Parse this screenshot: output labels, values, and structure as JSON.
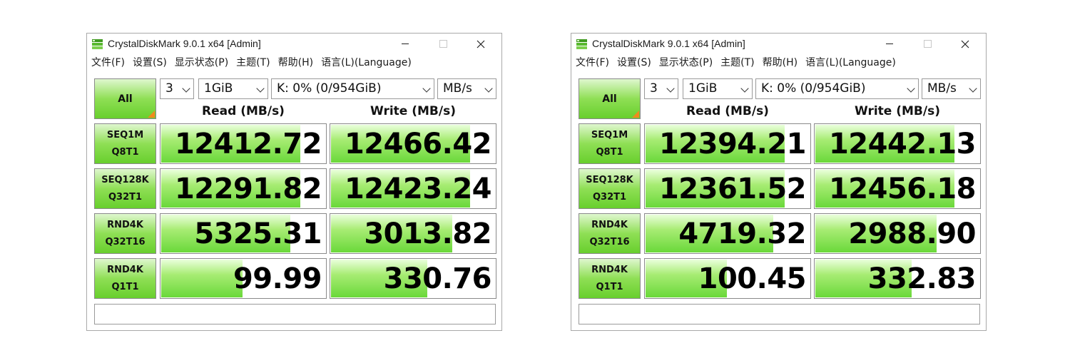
{
  "windows": [
    {
      "title": "CrystalDiskMark 9.0.1 x64 [Admin]",
      "menu": [
        "文件(F)",
        "设置(S)",
        "显示状态(P)",
        "主题(T)",
        "帮助(H)",
        "语言(L)(Language)"
      ],
      "all_label": "All",
      "count": "3",
      "size": "1GiB",
      "drive": "K: 0% (0/954GiB)",
      "unit": "MB/s",
      "read_header": "Read (MB/s)",
      "write_header": "Write (MB/s)",
      "tests": [
        {
          "line1": "SEQ1M",
          "line2": "Q8T1",
          "read": "12412.72",
          "write": "12466.42",
          "read_level": 0.85,
          "write_level": 0.85
        },
        {
          "line1": "SEQ128K",
          "line2": "Q32T1",
          "read": "12291.82",
          "write": "12423.24",
          "read_level": 0.85,
          "write_level": 0.85
        },
        {
          "line1": "RND4K",
          "line2": "Q32T16",
          "read": "5325.31",
          "write": "3013.82",
          "read_level": 0.79,
          "write_level": 0.74
        },
        {
          "line1": "RND4K",
          "line2": "Q1T1",
          "read": "99.99",
          "write": "330.76",
          "read_level": 0.5,
          "write_level": 0.59
        }
      ]
    },
    {
      "title": "CrystalDiskMark 9.0.1 x64 [Admin]",
      "menu": [
        "文件(F)",
        "设置(S)",
        "显示状态(P)",
        "主题(T)",
        "帮助(H)",
        "语言(L)(Language)"
      ],
      "all_label": "All",
      "count": "3",
      "size": "1GiB",
      "drive": "K: 0% (0/954GiB)",
      "unit": "MB/s",
      "read_header": "Read (MB/s)",
      "write_header": "Write (MB/s)",
      "tests": [
        {
          "line1": "SEQ1M",
          "line2": "Q8T1",
          "read": "12394.21",
          "write": "12442.13",
          "read_level": 0.85,
          "write_level": 0.85
        },
        {
          "line1": "SEQ128K",
          "line2": "Q32T1",
          "read": "12361.52",
          "write": "12456.18",
          "read_level": 0.85,
          "write_level": 0.85
        },
        {
          "line1": "RND4K",
          "line2": "Q32T16",
          "read": "4719.32",
          "write": "2988.90",
          "read_level": 0.78,
          "write_level": 0.74
        },
        {
          "line1": "RND4K",
          "line2": "Q1T1",
          "read": "100.45",
          "write": "332.83",
          "read_level": 0.5,
          "write_level": 0.59
        }
      ]
    }
  ],
  "colors": {
    "accent_green": "#68cf2d",
    "corner_orange": "#f0891f"
  },
  "icons": {
    "app": "crystaldiskmark-app-icon",
    "minimize": "minimize-icon",
    "maximize": "maximize-icon",
    "close": "close-icon",
    "dropdown": "chevron-down-icon"
  }
}
